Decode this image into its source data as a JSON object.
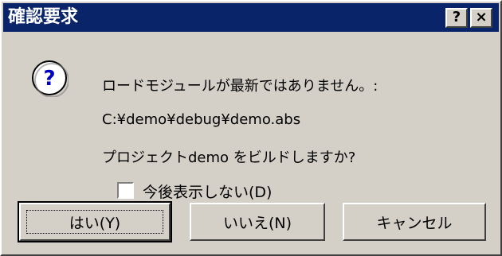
{
  "window": {
    "title": "確認要求",
    "help_label": "?",
    "close_label": "×"
  },
  "icon": {
    "name": "question-icon",
    "glyph": "?"
  },
  "message": {
    "line1": "ロードモジュールが最新ではありません。:",
    "path": "C:¥demo¥debug¥demo.abs",
    "question": "プロジェクトdemo をビルドしますか?"
  },
  "checkbox": {
    "label": "今後表示しない(D)",
    "checked": false
  },
  "buttons": {
    "yes": "はい(Y)",
    "no": "いいえ(N)",
    "cancel": "キャンセル"
  }
}
